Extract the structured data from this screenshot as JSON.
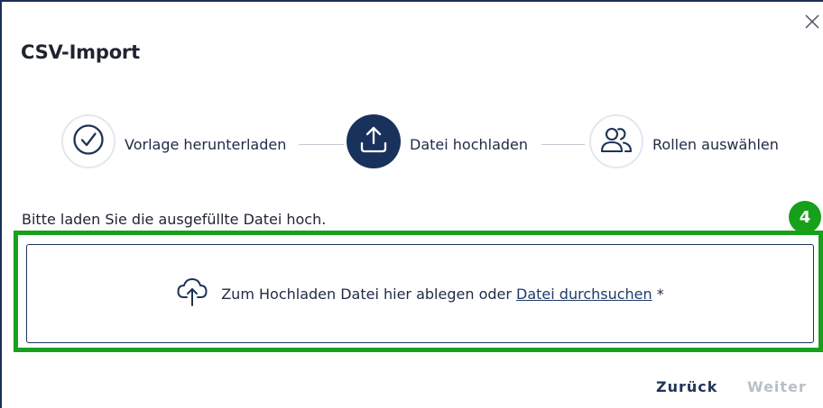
{
  "dialog": {
    "title": "CSV-Import",
    "close_icon": "close-icon"
  },
  "stepper": {
    "steps": [
      {
        "label": "Vorlage herunterladen",
        "icon": "check-circle-icon",
        "state": "done"
      },
      {
        "label": "Datei hochladen",
        "icon": "upload-icon",
        "state": "active"
      },
      {
        "label": "Rollen auswählen",
        "icon": "users-icon",
        "state": "todo"
      }
    ]
  },
  "upload": {
    "instruction": "Bitte laden Sie die ausgefüllte Datei hoch.",
    "drop_text": "Zum Hochladen Datei hier ablegen oder",
    "browse_link": "Datei durchsuchen",
    "required_marker": "*",
    "icon": "cloud-upload-icon"
  },
  "annotation": {
    "badge_number": "4",
    "highlight_color": "#17a019"
  },
  "footer": {
    "back_label": "Zurück",
    "next_label": "Weiter"
  },
  "colors": {
    "primary": "#19325c",
    "disabled": "#b9bfc8",
    "annotation": "#17a019"
  }
}
